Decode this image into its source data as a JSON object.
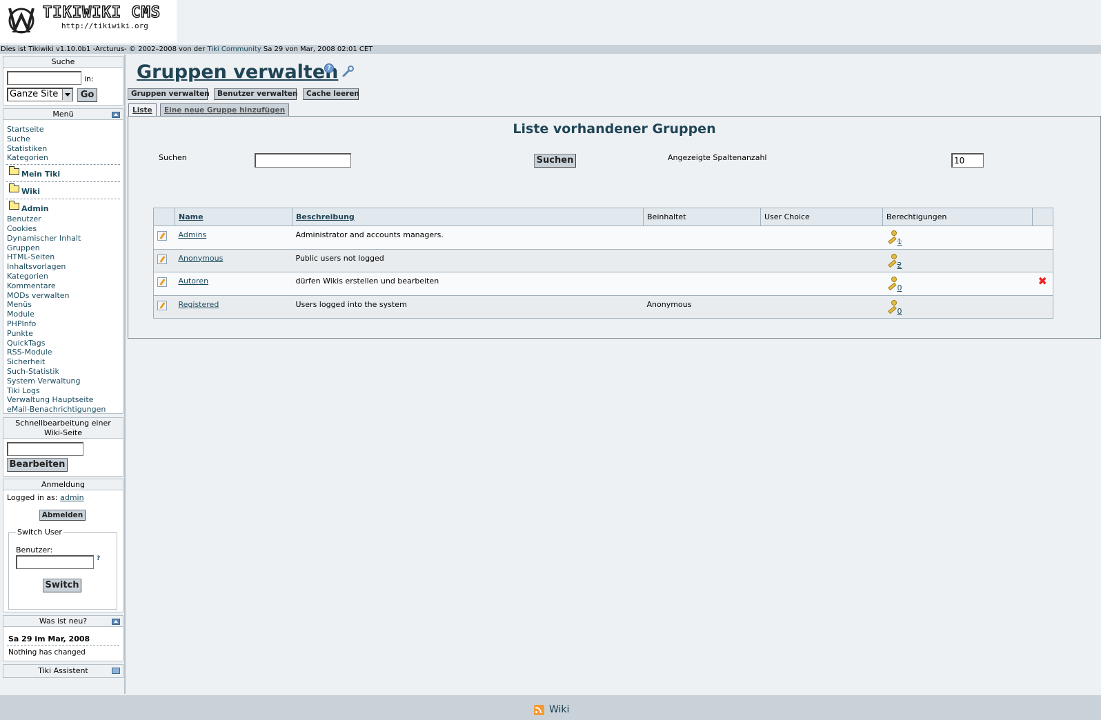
{
  "header": {
    "logo_title": "TIKIWIKI CMS",
    "logo_url": "http://tikiwiki.org",
    "info_prefix": "Dies ist Tikiwiki v1.10.0b1 -Arcturus- © 2002–2008 von der",
    "info_link": "Tiki Community",
    "info_date": "Sa 29 von Mar, 2008 02:01 CET"
  },
  "search_box": {
    "title": "Suche",
    "in_label": "in:",
    "scope_value": "Ganze Site",
    "go_label": "Go"
  },
  "menu_box": {
    "title": "Menü",
    "top_links": [
      "Startseite",
      "Suche",
      "Statistiken",
      "Kategorien"
    ],
    "folders": [
      "Mein Tiki",
      "Wiki",
      "Admin"
    ],
    "admin_links": [
      "Benutzer",
      "Cookies",
      "Dynamischer Inhalt",
      "Gruppen",
      "HTML-Seiten",
      "Inhaltsvorlagen",
      "Kategorien",
      "Kommentare",
      "MODs verwalten",
      "Menüs",
      "Module",
      "PHPInfo",
      "Punkte",
      "QuickTags",
      "RSS-Module",
      "Sicherheit",
      "Such-Statistik",
      "System Verwaltung",
      "Tiki Logs",
      "Verwaltung Hauptseite",
      "eMail-Benachrichtigungen"
    ]
  },
  "quickedit_box": {
    "title_line1": "Schnellbearbeitung einer",
    "title_line2": "Wiki-Seite",
    "edit_label": "Bearbeiten"
  },
  "login_box": {
    "title": "Anmeldung",
    "logged_in_label": "Logged in as:",
    "user": "admin",
    "logout_label": "Abmelden",
    "switch_legend": "Switch User",
    "user_label": "Benutzer:",
    "help_mark": "?",
    "switch_label": "Switch"
  },
  "whatsnew_box": {
    "title": "Was ist neu?",
    "date": "Sa 29 im Mar, 2008",
    "status": "Nothing has changed"
  },
  "assistant_box": {
    "title": "Tiki Assistent"
  },
  "main": {
    "page_title": "Gruppen verwalten",
    "toolbar": [
      "Gruppen verwalten",
      "Benutzer verwalten",
      "Cache leeren"
    ],
    "tabs": [
      "Liste",
      "Eine neue Gruppe hinzufügen"
    ],
    "panel_title": "Liste vorhandener Gruppen",
    "find_label": "Suchen",
    "find_button": "Suchen",
    "rows_label": "Angezeigte Spaltenanzahl",
    "rows_value": "10",
    "columns": [
      "Name",
      "Beschreibung",
      "Beinhaltet",
      "User Choice",
      "Berechtigungen"
    ],
    "groups": [
      {
        "name": "Admins",
        "description": "Administrator and accounts managers.",
        "includes": "",
        "user_choice": "",
        "perms": "1"
      },
      {
        "name": "Anonymous",
        "description": "Public users not logged",
        "includes": "",
        "user_choice": "",
        "perms": "2"
      },
      {
        "name": "Autoren",
        "description": "dürfen Wikis erstellen und bearbeiten",
        "includes": "",
        "user_choice": "",
        "perms": "0"
      },
      {
        "name": "Registered",
        "description": "Users logged into the system",
        "includes": "Anonymous",
        "user_choice": "",
        "perms": "0"
      }
    ]
  },
  "footer": {
    "rss_label": "Wiki"
  }
}
